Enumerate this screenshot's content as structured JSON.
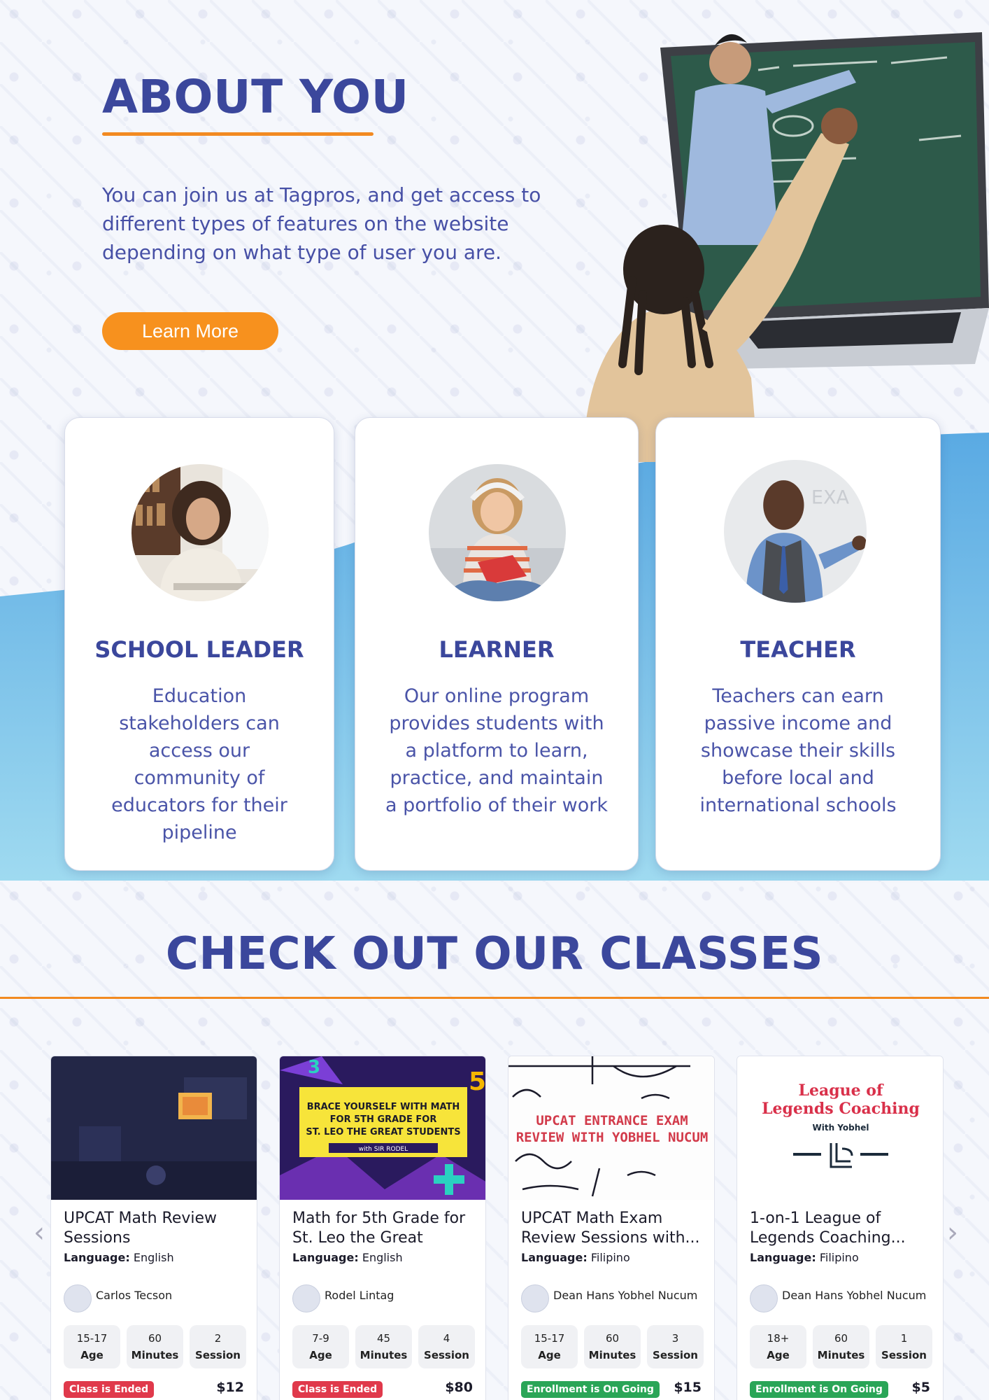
{
  "hero": {
    "title": "ABOUT YOU",
    "text": "You can join us at Tagpros, and get access to different types of features on the website depending on what type of user you are.",
    "button": "Learn More"
  },
  "roles": [
    {
      "title": "SCHOOL LEADER",
      "description": "Education stakeholders can access our community of educators for their pipeline"
    },
    {
      "title": "LEARNER",
      "description": "Our online program provides students with a platform to learn, practice, and maintain a portfolio of their work"
    },
    {
      "title": "TEACHER",
      "description": "Teachers can earn passive income and showcase their skills before local and international schools"
    }
  ],
  "classes": {
    "title": "CHECK OUT OUR CLASSES",
    "language_label": "Language:",
    "stat_labels": {
      "age": "Age",
      "minutes": "Minutes",
      "session": "Session"
    },
    "items": [
      {
        "name": "UPCAT Math Review Sessions",
        "language": "English",
        "teacher": "Carlos Tecson",
        "age": "15-17",
        "minutes": "60",
        "sessions": "2",
        "status": "Class is Ended",
        "status_color": "#e0394b",
        "price": "$12"
      },
      {
        "name": "Math for 5th Grade for St. Leo the Great",
        "language": "English",
        "teacher": "Rodel Lintag",
        "age": "7-9",
        "minutes": "45",
        "sessions": "4",
        "status": "Class is Ended",
        "status_color": "#e0394b",
        "price": "$80",
        "banner": {
          "line1": "BRACE YOURSELF WITH MATH",
          "line2": "FOR 5TH GRADE FOR",
          "line3": "ST. LEO THE GREAT STUDENTS",
          "with": "with  SIR RODEL"
        }
      },
      {
        "name": "UPCAT Math Exam Review Sessions with...",
        "language": "Filipino",
        "teacher": "Dean Hans Yobhel Nucum",
        "age": "15-17",
        "minutes": "60",
        "sessions": "3",
        "status": "Enrollment is On Going",
        "status_color": "#2aa557",
        "price": "$15",
        "banner": {
          "line1": "UPCAT ENTRANCE EXAM",
          "line2": "REVIEW WITH YOBHEL NUCUM"
        }
      },
      {
        "name": "1-on-1 League of Legends Coaching...",
        "language": "Filipino",
        "teacher": "Dean Hans Yobhel Nucum",
        "age": "18+",
        "minutes": "60",
        "sessions": "1",
        "status": "Enrollment is On Going",
        "status_color": "#2aa557",
        "price": "$5",
        "banner": {
          "line1": "League of",
          "line2": "Legends Coaching",
          "with": "With Yobhel"
        }
      }
    ]
  },
  "colors": {
    "brand_blue": "#3b479c",
    "accent_orange": "#f28a21",
    "band_blue": "#7cc1e8"
  }
}
